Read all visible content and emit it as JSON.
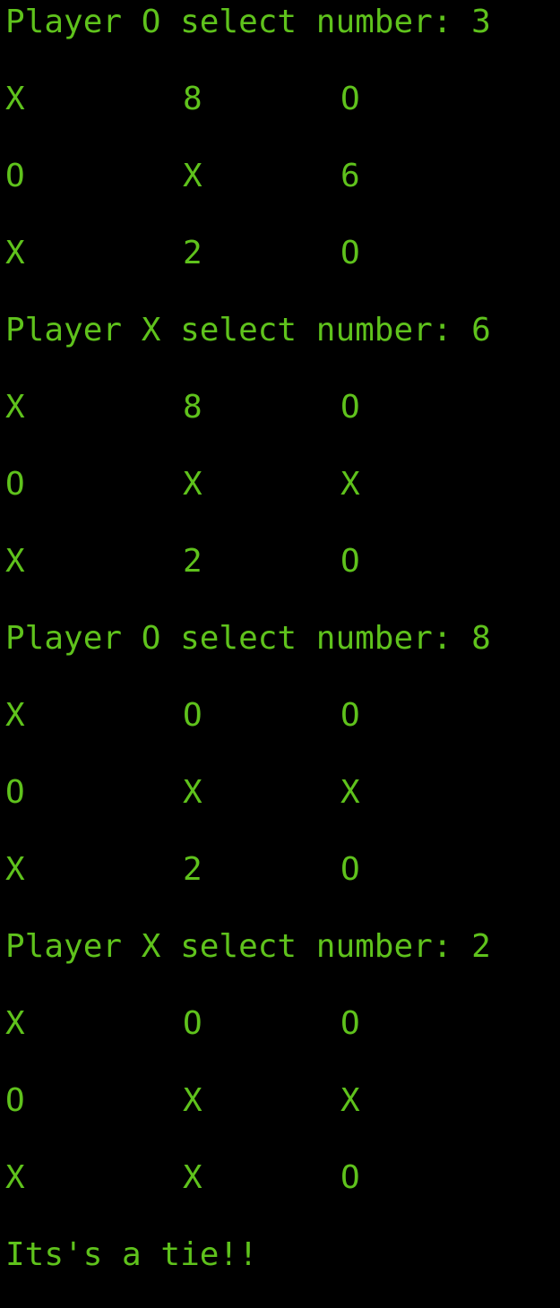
{
  "colors": {
    "background": "#000000",
    "text": "#5fc21c"
  },
  "lines": [
    {
      "type": "prompt",
      "text": "Player O select number: 3"
    },
    {
      "type": "row",
      "cells": [
        "X",
        "8",
        "O"
      ]
    },
    {
      "type": "row",
      "cells": [
        "O",
        "X",
        "6"
      ]
    },
    {
      "type": "row",
      "cells": [
        "X",
        "2",
        "O"
      ]
    },
    {
      "type": "prompt",
      "text": "Player X select number: 6"
    },
    {
      "type": "row",
      "cells": [
        "X",
        "8",
        "O"
      ]
    },
    {
      "type": "row",
      "cells": [
        "O",
        "X",
        "X"
      ]
    },
    {
      "type": "row",
      "cells": [
        "X",
        "2",
        "O"
      ]
    },
    {
      "type": "prompt",
      "text": "Player O select number: 8"
    },
    {
      "type": "row",
      "cells": [
        "X",
        "O",
        "O"
      ]
    },
    {
      "type": "row",
      "cells": [
        "O",
        "X",
        "X"
      ]
    },
    {
      "type": "row",
      "cells": [
        "X",
        "2",
        "O"
      ]
    },
    {
      "type": "prompt",
      "text": "Player X select number: 2"
    },
    {
      "type": "row",
      "cells": [
        "X",
        "O",
        "O"
      ]
    },
    {
      "type": "row",
      "cells": [
        "O",
        "X",
        "X"
      ]
    },
    {
      "type": "row",
      "cells": [
        "X",
        "X",
        "O"
      ]
    },
    {
      "type": "result",
      "text": "Its's a tie!!"
    }
  ]
}
